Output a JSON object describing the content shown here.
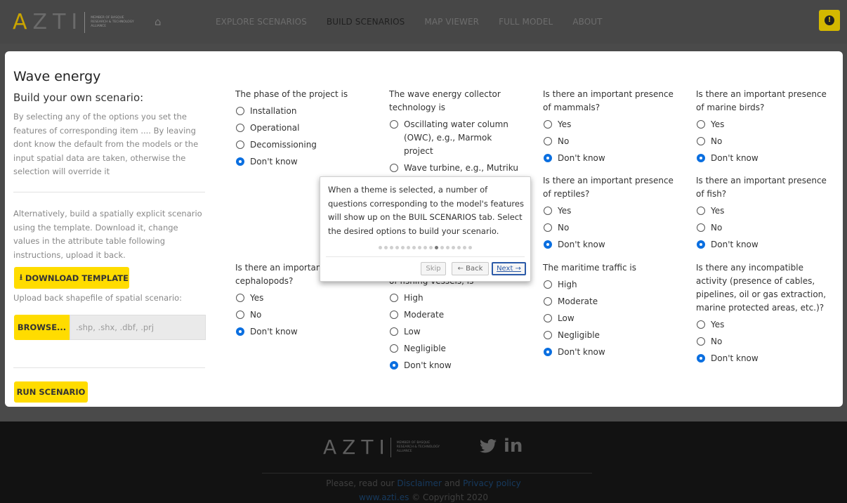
{
  "navbar": {
    "logo_text": "AZTI",
    "logo_alliance": "Member of Basque Research & Technology Alliance",
    "items": [
      {
        "label": "EXPLORE SCENARIOS"
      },
      {
        "label": "BUILD SCENARIOS",
        "active": true
      },
      {
        "label": "MAP VIEWER"
      },
      {
        "label": "FULL MODEL"
      },
      {
        "label": "ABOUT"
      }
    ],
    "info_icon": "info-icon",
    "home_icon": "home-icon"
  },
  "sidebar": {
    "title": "Wave energy",
    "subtitle": "Build your own scenario:",
    "description": "By selecting any of the options you set the features of corresponding item .... By leaving dont know the default from the models or the input spatial data are taken, otherwise the selection will override it",
    "alt_text": "Alternatively, build a spatially explicit scenario using the template. Download it, change values in the attribute table following instructions, upload it back.",
    "download_label": "DOWNLOAD TEMPLATE",
    "upload_label": "Upload back shapefile of spatial scenario:",
    "browse_label": "BROWSE...",
    "browse_placeholder": ".shp, .shx, .dbf, .prj",
    "run_label": "RUN SCENARIO"
  },
  "questions": {
    "phase": {
      "label": "The phase of the project is",
      "options": [
        "Installation",
        "Operational",
        "Decomissioning",
        "Don't know"
      ],
      "selected": 3
    },
    "technology": {
      "label": "The wave energy collector technology is",
      "options": [
        "Oscillating water column (OWC), e.g., Marmok project",
        "Wave turbine, e.g., Mutriku project"
      ]
    },
    "mammals": {
      "label": "Is there an important presence of mammals?",
      "options": [
        "Yes",
        "No",
        "Don't know"
      ],
      "selected": 2
    },
    "birds": {
      "label": "Is there an important presence of marine birds?",
      "options": [
        "Yes",
        "No",
        "Don't know"
      ],
      "selected": 2
    },
    "reptiles": {
      "label": "Is there an important presence of reptiles?",
      "options": [
        "Yes",
        "No",
        "Don't know"
      ],
      "selected": 2
    },
    "fish": {
      "label": "Is there an important presence of fish?",
      "options": [
        "Yes",
        "No",
        "Don't know"
      ],
      "selected": 2
    },
    "cephalopods": {
      "label": "Is there an important presence of cephalopods?",
      "label_visible": "Is there an important",
      "label_line2": "cephalopods?",
      "options": [
        "Yes",
        "No",
        "Don't know"
      ],
      "selected": 2
    },
    "fishing": {
      "label_partial": "of fishing vessels, is",
      "options": [
        "High",
        "Moderate",
        "Low",
        "Negligible",
        "Don't know"
      ],
      "selected": 4
    },
    "traffic": {
      "label": "The maritime traffic is",
      "options": [
        "High",
        "Moderate",
        "Low",
        "Negligible",
        "Don't know"
      ],
      "selected": 4
    },
    "incompatible": {
      "label": "Is there any incompatible activity (presence of cables, pipelines, oil or gas extraction, marine protected areas, etc.)?",
      "options": [
        "Yes",
        "No",
        "Don't know"
      ],
      "selected": 2
    }
  },
  "tour": {
    "text": "When a theme is selected, a number of questions corresponding to the model's features will show up on the BUIL SCENARIOS tab. Select the desired options to build your scenario.",
    "step_index": 10,
    "step_count": 17,
    "skip_label": "Skip",
    "back_label": "← Back",
    "next_label": "Next →"
  },
  "footer": {
    "logo_text": "AZTI",
    "logo_alliance": "Member of Basque Research & Technology Alliance",
    "twitter_icon": "twitter-icon",
    "linkedin_label": "in",
    "text_prefix": "Please, read our",
    "disclaimer_link": "Disclaimer",
    "and_text": "and",
    "privacy_link": "Privacy policy",
    "site_link": "www.azti.es",
    "copyright": "© Copyright 2020"
  }
}
